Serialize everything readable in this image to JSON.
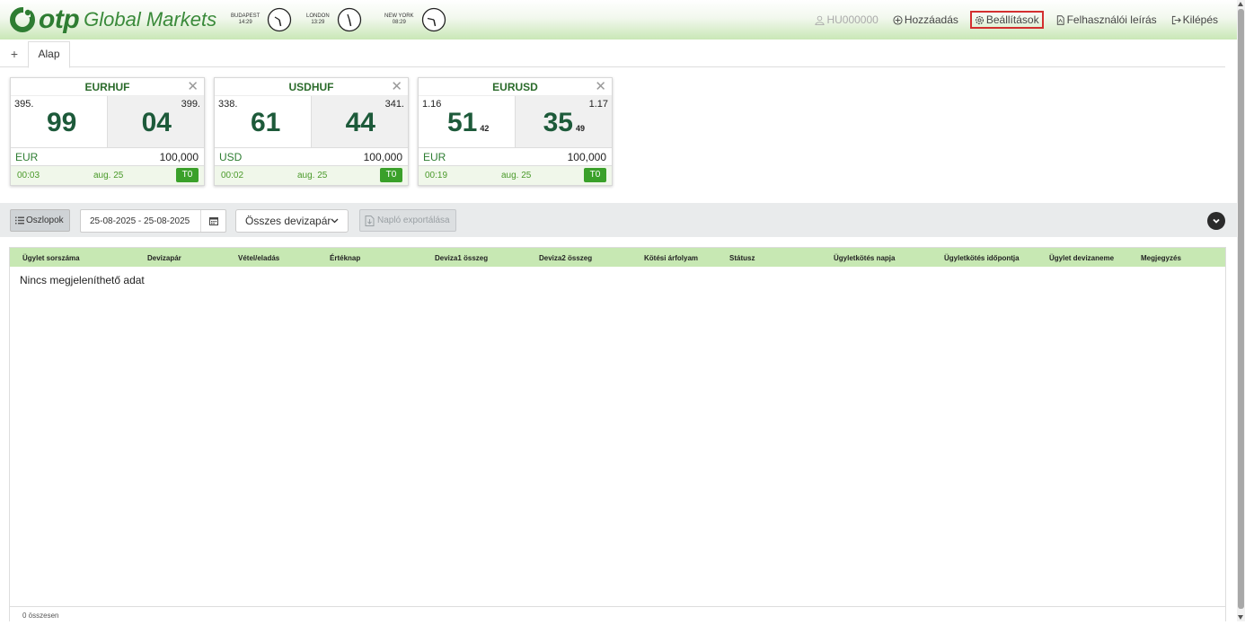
{
  "brand": {
    "otp": "otp",
    "global_markets": "Global Markets",
    "color": "#2e7d32"
  },
  "clocks": [
    {
      "city": "BUDAPEST",
      "time": "14:29"
    },
    {
      "city": "LONDON",
      "time": "13:29"
    },
    {
      "city": "NEW YORK",
      "time": "08:29"
    }
  ],
  "topnav": {
    "user": "HU000000",
    "add": "Hozzáadás",
    "settings": "Beállítások",
    "manual": "Felhasználói leírás",
    "logout": "Kilépés"
  },
  "tabs": {
    "add": "+",
    "active": "Alap"
  },
  "tiles": [
    {
      "pair": "EURHUF",
      "sell_small": "395.",
      "sell_big": "99",
      "sell_pip": "",
      "buy_small": "399.",
      "buy_big": "04",
      "buy_pip": "",
      "currency": "EUR",
      "amount": "100,000",
      "time": "00:03",
      "date": "aug. 25",
      "tenor": "T0"
    },
    {
      "pair": "USDHUF",
      "sell_small": "338.",
      "sell_big": "61",
      "sell_pip": "",
      "buy_small": "341.",
      "buy_big": "44",
      "buy_pip": "",
      "currency": "USD",
      "amount": "100,000",
      "time": "00:02",
      "date": "aug. 25",
      "tenor": "T0"
    },
    {
      "pair": "EURUSD",
      "sell_small": "1.16",
      "sell_big": "51",
      "sell_pip": "42",
      "buy_small": "1.17",
      "buy_big": "35",
      "buy_pip": "49",
      "currency": "EUR",
      "amount": "100,000",
      "time": "00:19",
      "date": "aug. 25",
      "tenor": "T0"
    }
  ],
  "toolbar": {
    "columns": "Oszlopok",
    "date_range": "25-08-2025 - 25-08-2025",
    "pair_filter": "Összes devizapár",
    "export": "Napló exportálása"
  },
  "table": {
    "columns": [
      "Ügylet sorszáma",
      "Devizapár",
      "Vétel/eladás",
      "Értéknap",
      "Deviza1 összeg",
      "Deviza2 összeg",
      "Kötési árfolyam",
      "Státusz",
      "Ügyletkötés napja",
      "Ügyletkötés időpontja",
      "Ügylet devizaneme",
      "Megjegyzés"
    ],
    "empty_message": "Nincs megjeleníthető adat",
    "footer": "0 összesen"
  }
}
